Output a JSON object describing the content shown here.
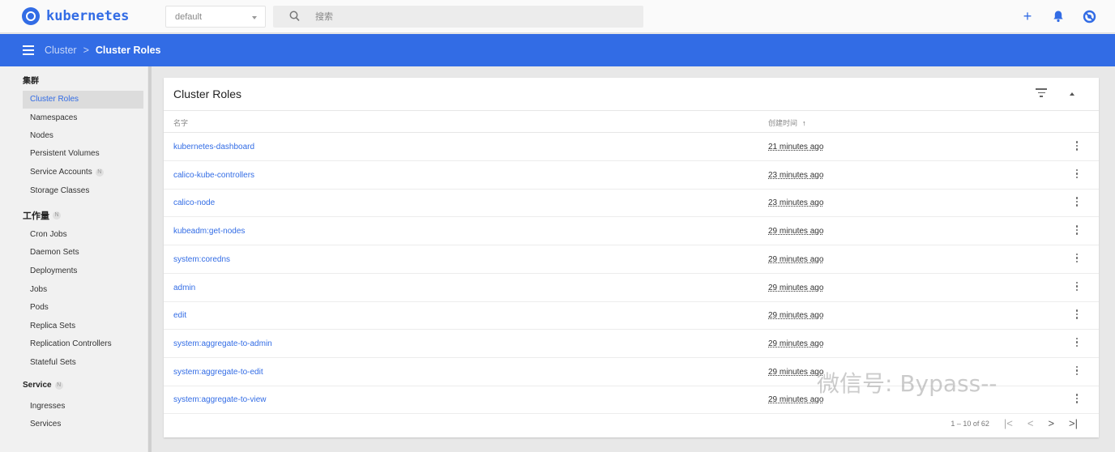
{
  "brand": {
    "name": "kubernetes",
    "color": "#326ce5"
  },
  "namespace": {
    "value": "default"
  },
  "search": {
    "placeholder": "搜索"
  },
  "top_actions": [
    {
      "icon": "add-icon",
      "glyph": "+"
    },
    {
      "icon": "bell-icon",
      "glyph": "🔔"
    },
    {
      "icon": "help-icon",
      "glyph": "⊘"
    }
  ],
  "breadcrumb": {
    "parent": "Cluster",
    "separator": ">",
    "current": "Cluster Roles"
  },
  "sidebar": {
    "sections": [
      {
        "label": "集群",
        "badge": ""
      },
      {
        "label": "工作量",
        "badge": "N"
      },
      {
        "label": "Service",
        "badge": "N"
      }
    ],
    "cluster_items": [
      {
        "label": "Cluster Roles",
        "active": true,
        "badge": ""
      },
      {
        "label": "Namespaces",
        "badge": ""
      },
      {
        "label": "Nodes",
        "badge": ""
      },
      {
        "label": "Persistent Volumes",
        "badge": ""
      },
      {
        "label": "Service Accounts",
        "badge": "N"
      },
      {
        "label": "Storage Classes",
        "badge": ""
      }
    ],
    "workload_items": [
      {
        "label": "Cron Jobs"
      },
      {
        "label": "Daemon Sets"
      },
      {
        "label": "Deployments"
      },
      {
        "label": "Jobs"
      },
      {
        "label": "Pods"
      },
      {
        "label": "Replica Sets"
      },
      {
        "label": "Replication Controllers"
      },
      {
        "label": "Stateful Sets"
      }
    ],
    "service_items": [
      {
        "label": "Ingresses"
      },
      {
        "label": "Services"
      }
    ]
  },
  "card": {
    "title": "Cluster Roles",
    "columns": {
      "name": "名字",
      "created": "创建时间",
      "sort_arrow": "↑"
    },
    "rows": [
      {
        "name": "kubernetes-dashboard",
        "created": "21 minutes ago"
      },
      {
        "name": "calico-kube-controllers",
        "created": "23 minutes ago"
      },
      {
        "name": "calico-node",
        "created": "23 minutes ago"
      },
      {
        "name": "kubeadm:get-nodes",
        "created": "29 minutes ago"
      },
      {
        "name": "system:coredns",
        "created": "29 minutes ago"
      },
      {
        "name": "admin",
        "created": "29 minutes ago"
      },
      {
        "name": "edit",
        "created": "29 minutes ago"
      },
      {
        "name": "system:aggregate-to-admin",
        "created": "29 minutes ago"
      },
      {
        "name": "system:aggregate-to-edit",
        "created": "29 minutes ago"
      },
      {
        "name": "system:aggregate-to-view",
        "created": "29 minutes ago"
      }
    ],
    "pagination": {
      "range": "1 – 10 of 62",
      "first": "|<",
      "prev": "<",
      "next": ">",
      "last": ">|"
    }
  },
  "watermark": "微信号: Bypass--"
}
